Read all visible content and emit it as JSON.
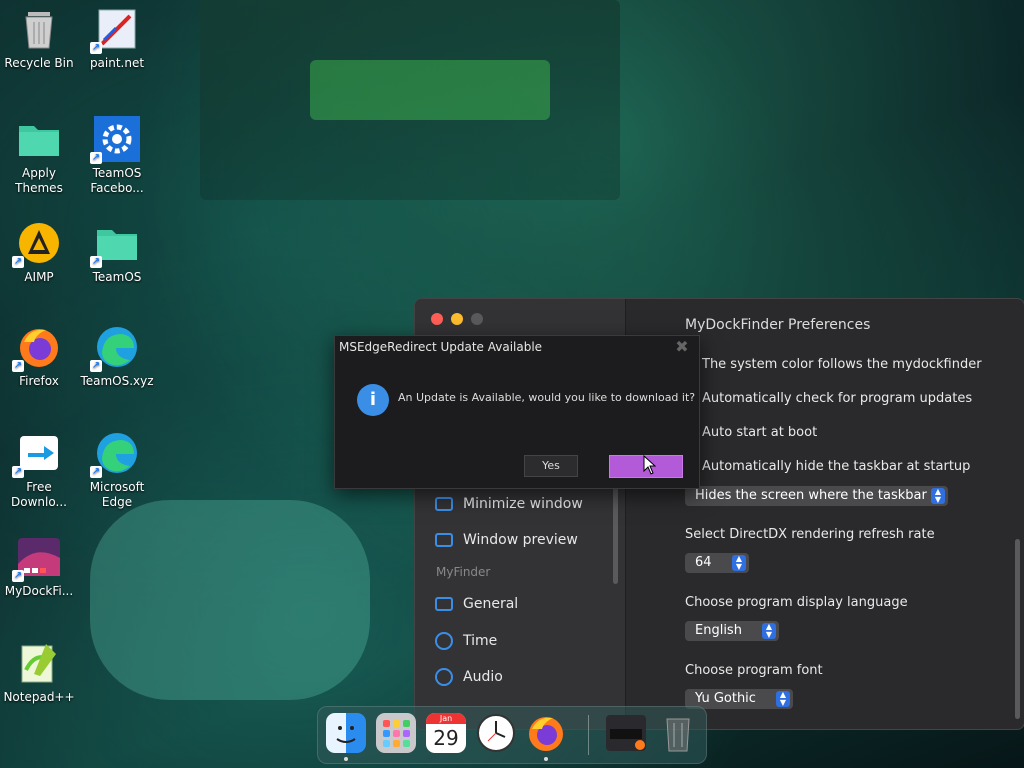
{
  "desktop": {
    "icons": [
      {
        "label": "Recycle Bin",
        "icon": "recycle-bin-icon"
      },
      {
        "label": "paint.net",
        "icon": "paint-net-icon"
      },
      {
        "label": "Apply Themes",
        "icon": "folder-icon"
      },
      {
        "label": "TeamOS Facebo...",
        "icon": "gear-icon"
      },
      {
        "label": "AIMP",
        "icon": "aimp-icon"
      },
      {
        "label": "TeamOS",
        "icon": "folder-icon"
      },
      {
        "label": "Firefox",
        "icon": "firefox-icon"
      },
      {
        "label": "TeamOS.xyz",
        "icon": "edge-icon"
      },
      {
        "label": "Free Downlo...",
        "icon": "download-icon"
      },
      {
        "label": "Microsoft Edge",
        "icon": "edge-icon"
      },
      {
        "label": "MyDockFi...",
        "icon": "mydockfinder-icon"
      },
      {
        "label": "Notepad++",
        "icon": "notepad-plus-plus-icon"
      }
    ]
  },
  "prefs": {
    "title": "MyDockFinder Preferences",
    "sidebar": {
      "items_top": [
        {
          "label": "Minimize window",
          "icon": "minimize-window-icon"
        },
        {
          "label": "Window preview",
          "icon": "window-preview-icon"
        }
      ],
      "section": "MyFinder",
      "items_bottom": [
        {
          "label": "General",
          "icon": "general-icon"
        },
        {
          "label": "Time",
          "icon": "clock-icon"
        },
        {
          "label": "Audio",
          "icon": "audio-icon"
        }
      ]
    },
    "options": [
      "The system color follows the mydockfinder",
      "Automatically check for program updates",
      "Auto start at boot",
      "Automatically hide the taskbar at startup"
    ],
    "taskbar_select": "Hides the screen where the taskbar",
    "refresh_label": "Select DirectDX rendering refresh rate",
    "refresh_value": "64",
    "language_label": "Choose program display language",
    "language_value": "English",
    "font_label": "Choose program font",
    "font_value": "Yu Gothic"
  },
  "dialog": {
    "title": "MSEdgeRedirect Update Available",
    "message": "An Update is Available, would you like to download it?",
    "yes_label": "Yes",
    "no_label": ""
  },
  "dock": {
    "apps": [
      "finder-icon",
      "launchpad-icon",
      "calendar-icon",
      "clock-icon",
      "firefox-icon",
      "screenshot-icon",
      "trash-icon"
    ],
    "calendar_month": "Jan",
    "calendar_day": "29"
  },
  "colors": {
    "accent": "#2f6fe0",
    "dialog_button": "#b35ad8",
    "close": "#ff5f57",
    "minimize": "#febc2e",
    "maximize": "#5a5a5d"
  }
}
